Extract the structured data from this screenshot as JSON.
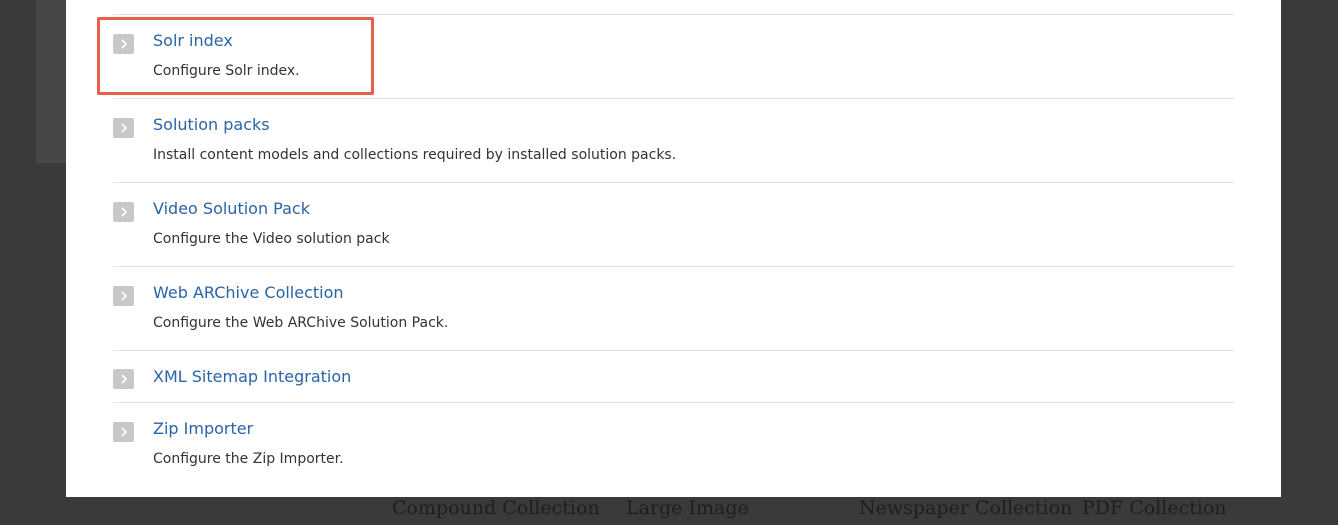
{
  "items": [
    {
      "title": "Solr index",
      "desc": "Configure Solr index."
    },
    {
      "title": "Solution packs",
      "desc": "Install content models and collections required by installed solution packs."
    },
    {
      "title": "Video Solution Pack",
      "desc": "Configure the Video solution pack"
    },
    {
      "title": "Web ARChive Collection",
      "desc": "Configure the Web ARChive Solution Pack."
    },
    {
      "title": "XML Sitemap Integration"
    },
    {
      "title": "Zip Importer",
      "desc": "Configure the Zip Importer."
    }
  ],
  "background": {
    "collections": [
      "Compound Collection",
      "Large Image",
      "Newspaper Collection",
      "PDF Collection"
    ]
  },
  "colors": {
    "link": "#2a64a8",
    "highlight": "#e8604a",
    "overlay": "#3a3a3a"
  }
}
